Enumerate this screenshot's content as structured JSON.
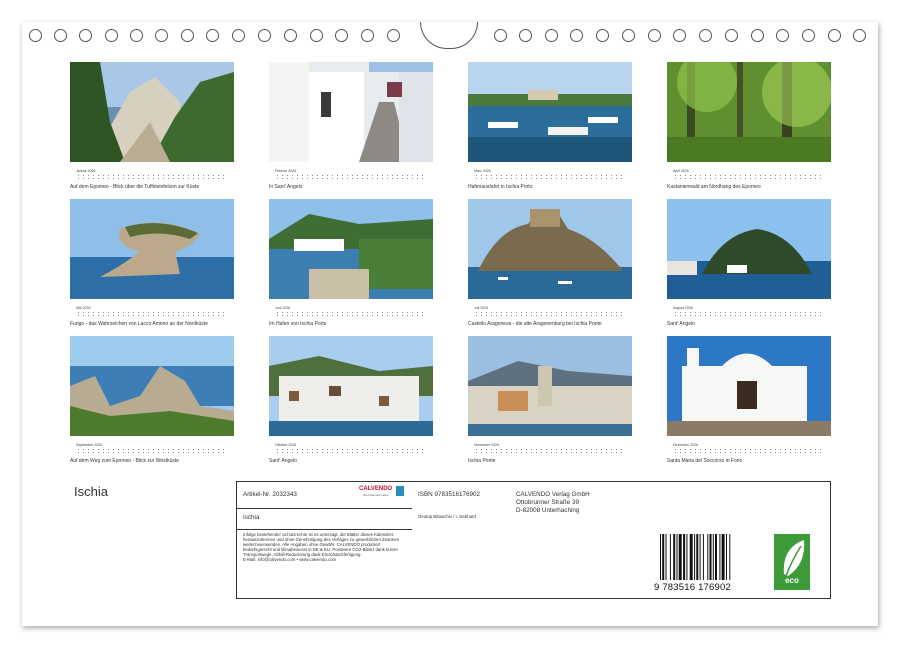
{
  "months": [
    {
      "label": "Januar 2026",
      "caption": "Auf dem Epomeo - Blick über die Tuffsteinfelsen zur Küste"
    },
    {
      "label": "Februar 2026",
      "caption": "In Sant' Angelo"
    },
    {
      "label": "März 2026",
      "caption": "Hafenausfahrt in Ischia Porto"
    },
    {
      "label": "April 2026",
      "caption": "Kastanienwald am Nordhang des Epomeo"
    },
    {
      "label": "Mai 2026",
      "caption": "Fungo - das Wahrzeichen von Lacco Ameno an der Nordküste"
    },
    {
      "label": "Juni 2026",
      "caption": "Im Hafen von Ischia Porto"
    },
    {
      "label": "Juli 2026",
      "caption": "Castello Aragonese - die alte Aragonenburg bei Ischia Ponte"
    },
    {
      "label": "August 2026",
      "caption": "Sant' Angelo"
    },
    {
      "label": "September 2026",
      "caption": "Auf dem Weg zum Epomeo - Blick zur Westküste"
    },
    {
      "label": "Oktober 2026",
      "caption": "Sant' Angelo"
    },
    {
      "label": "November 2026",
      "caption": "Ischia Ponte"
    },
    {
      "label": "Dezember 2026",
      "caption": "Santa Maria del Soccorso in Forio"
    }
  ],
  "title": "Ischia",
  "product": {
    "article": "Artikel-Nr. 2032343",
    "brand": "CALVENDO",
    "brand_tagline": "Die Kalendermarke",
    "name": "Ischia",
    "legal": "Infolge bestehender Schutzrechte ist es untersagt, die Blätter dieses Kalenders herauszutrennen und ohne Genehmigung des Verlages zu gewerblichen Zwecken weiterzuverwenden. Alle Angaben ohne Gewähr. CALVENDO produziert bedarfsgerecht und klimabewusst in DE & EU. Positivere CO2-Bilanz dank kurzer Transportwege, Abfall-Reduzierung dank Einzelstückfertigung.",
    "email": "E-Mail: info@calvendo.com • www.calvendo.com",
    "isbn": "ISBN 9783516176902",
    "author": "Geotop Bildarchiv / I. Gebhard",
    "publisher": "CALVENDO Verlag GmbH",
    "street": "Ottobrunner Straße 39",
    "city": "D-82008 Unterhaching",
    "barcode_text": "9 783516 176902",
    "eco_label": "eco"
  }
}
